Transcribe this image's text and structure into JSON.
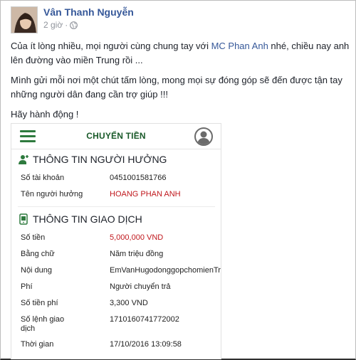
{
  "post": {
    "author": "Vân Thanh Nguyễn",
    "time": "2 giờ",
    "separator": "·",
    "paragraph1_before": "Của ít lòng nhiều, mọi người cùng chung tay với ",
    "mention": "MC Phan Anh",
    "paragraph1_after": " nhé, chiều nay anh lên đường vào miền Trung rồi ...",
    "paragraph2": "Mình gửi mỗi nơi một chút tấm lòng, mong mọi sự đóng góp sẽ đến được tận tay những người dân đang cần trợ giúp !!!",
    "paragraph3": "Hãy hành động !"
  },
  "icons": {
    "privacy": "globe-icon",
    "menu": "hamburger-menu-icon",
    "user": "user-avatar-icon",
    "recipient": "person-add-icon",
    "transaction": "phone-card-icon"
  },
  "colors": {
    "link": "#365899",
    "app_green": "#2e7a3e",
    "amount_red": "#c0171c"
  },
  "card": {
    "title": "CHUYỂN TIỀN",
    "recipient": {
      "heading": "THÔNG TIN NGƯỜI HƯỞNG",
      "rows": [
        {
          "label": "Số tài khoản",
          "value": "0451001581766"
        },
        {
          "label": "Tên người hưởng",
          "value": "HOANG PHAN ANH"
        }
      ]
    },
    "transaction": {
      "heading": "THÔNG TIN GIAO DỊCH",
      "rows": [
        {
          "label": "Số tiền",
          "value": "5,000,000 VND"
        },
        {
          "label": "Bằng chữ",
          "value": "Năm triệu đồng"
        },
        {
          "label": "Nội dung",
          "value": "EmVanHugodonggopchomienTrung"
        },
        {
          "label": "Phí",
          "value": "Người chuyển trả"
        },
        {
          "label": "Số tiền phí",
          "value": "3,300 VND"
        },
        {
          "label_line1": "Số lệnh giao",
          "label_line2": "dịch",
          "value": "1710160741772002"
        },
        {
          "label": "Thời gian",
          "value": "17/10/2016 13:09:58"
        }
      ]
    }
  }
}
